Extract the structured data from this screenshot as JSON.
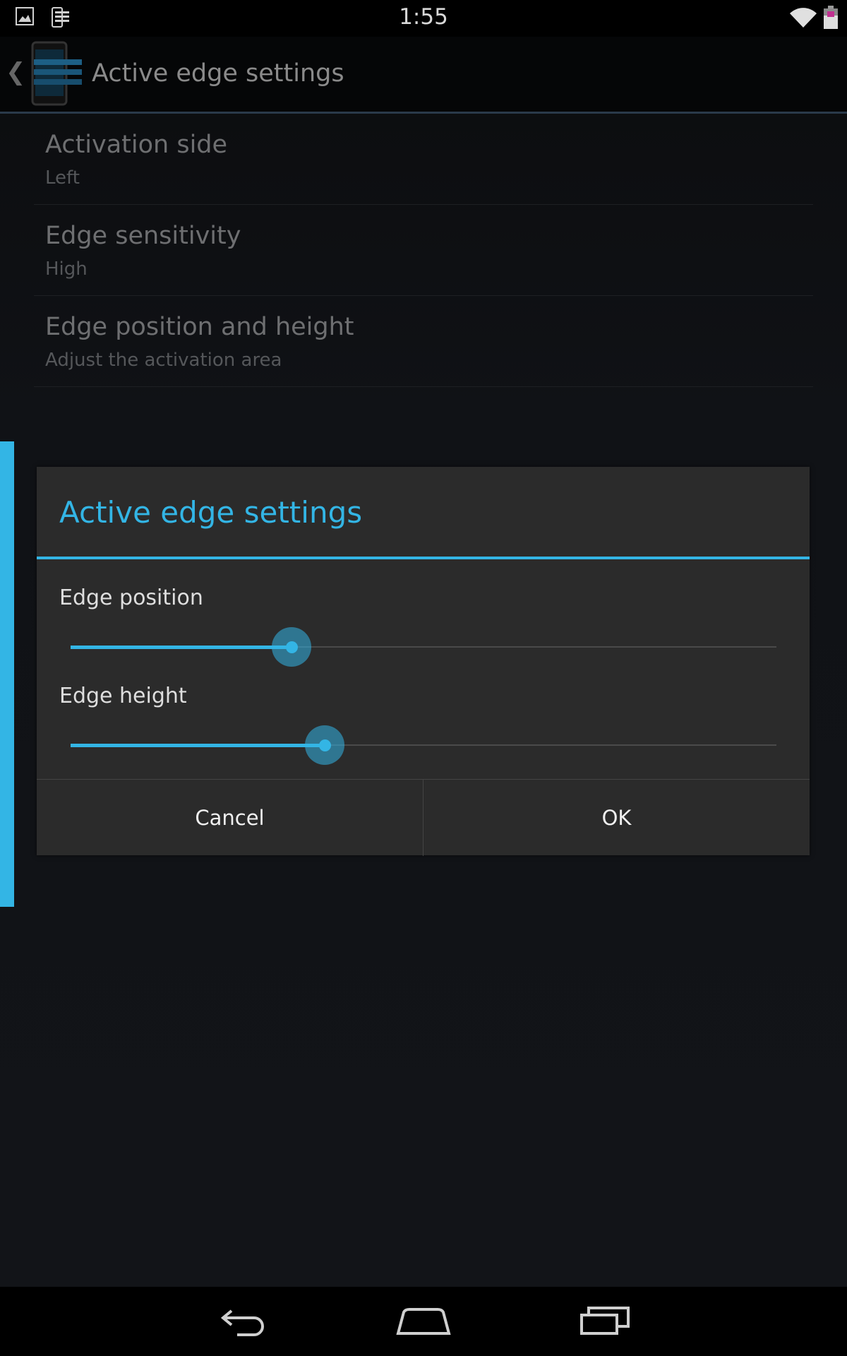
{
  "status_bar": {
    "time": "1:55",
    "left_icons": [
      "gallery-notification-icon",
      "device-notification-icon"
    ],
    "right_icons": [
      "wifi-icon",
      "battery-icon"
    ]
  },
  "action_bar": {
    "title": "Active edge settings",
    "back_icon": "chevron-left-icon",
    "app_icon": "app-icon"
  },
  "preferences": [
    {
      "title": "Activation side",
      "summary": "Left"
    },
    {
      "title": "Edge sensitivity",
      "summary": "High"
    },
    {
      "title": "Edge position and height",
      "summary": "Adjust the activation area"
    }
  ],
  "dialog": {
    "title": "Active edge settings",
    "sliders": [
      {
        "label": "Edge position",
        "value_fraction": 0.313
      },
      {
        "label": "Edge height",
        "value_fraction": 0.36
      }
    ],
    "cancel_label": "Cancel",
    "ok_label": "OK"
  },
  "colors": {
    "accent": "#33b5e5",
    "dialog_bg": "#2b2b2b",
    "screen_bg": "#101215"
  },
  "nav_bar": {
    "icons": [
      "back-icon",
      "home-icon",
      "recents-icon"
    ]
  }
}
